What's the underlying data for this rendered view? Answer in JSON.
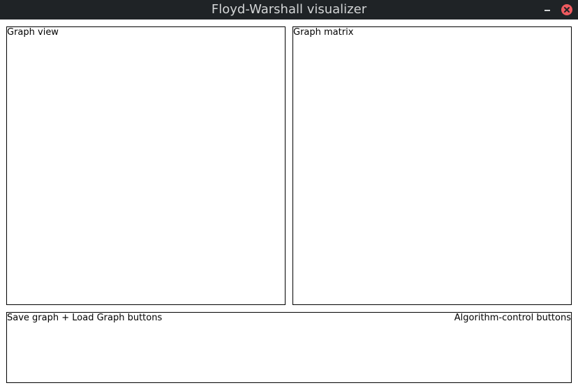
{
  "window": {
    "title": "Floyd-Warshall visualizer",
    "controls": {
      "minimize_icon": "minimize-icon",
      "close_icon": "close-icon",
      "close_color": "#ee5a5f"
    }
  },
  "panels": {
    "graph_view": {
      "label": "Graph view"
    },
    "graph_matrix": {
      "label": "Graph matrix"
    },
    "bottom": {
      "left_label": "Save graph + Load Graph buttons",
      "right_label": "Algorithm-control buttons"
    }
  },
  "colors": {
    "titlebar_bg": "#1f2326",
    "title_text": "#d3d5d6",
    "border": "#000000",
    "background": "#ffffff"
  }
}
